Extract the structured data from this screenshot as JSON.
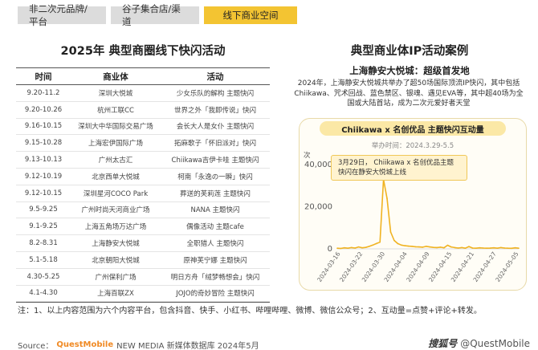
{
  "tabs": [
    {
      "label": "非二次元品牌/平台",
      "active": false
    },
    {
      "label": "谷子集合店/渠道",
      "active": false
    },
    {
      "label": "线下商业空间",
      "active": true
    }
  ],
  "left": {
    "title": "2025年 典型商圈线下快闪活动",
    "columns": [
      "时间",
      "商业体",
      "活动"
    ],
    "rows": [
      [
        "9.20-11.2",
        "深圳大悦城",
        "少女乐队的解构 主题快闪"
      ],
      [
        "9.20-10.26",
        "杭州工联CC",
        "世界之外「我即传说」快闪"
      ],
      [
        "9.16-10.15",
        "深圳大中华国际交易广场",
        "会长大人是女仆 主题快闪"
      ],
      [
        "9.15-10.28",
        "上海宏伊国际广场",
        "拓麻歌子「怀旧派对」快闪"
      ],
      [
        "9.13-10.13",
        "广州太古汇",
        "Chiikawa吉伊卡哇 主题快闪"
      ],
      [
        "9.12-10.19",
        "北京西单大悦城",
        "柯南「永逸の一瞬」快闪"
      ],
      [
        "9.12-10.15",
        "深圳星河COCO Park",
        "葬送的芙莉莲 主题快闪"
      ],
      [
        "9.5-9.25",
        "广州时尚天河商业广场",
        "NANA 主题快闪"
      ],
      [
        "9.1-9.25",
        "上海五角场万达广场",
        "偶像活动 主题cafe"
      ],
      [
        "8.2-8.31",
        "上海静安大悦城",
        "全职猎人 主题快闪"
      ],
      [
        "5.1-5.18",
        "北京朝阳大悦城",
        "原神芙宁娜 主题快闪"
      ],
      [
        "4.30-5.25",
        "广州保利广场",
        "明日方舟「绒梦畅想会」快闪"
      ],
      [
        "4.1-4.30",
        "上海百联ZX",
        "JOJO的奇妙冒险 主题快闪"
      ]
    ]
  },
  "right": {
    "title": "典型商业体IP活动案例",
    "case_title": "上海静安大悦城：超级首发地",
    "case_desc": "2024年，上海静安大悦城共举办了超50场国际顶流IP快闪，其中包括Chiikawa、咒术回战、蓝色禁区、银魂、遇见EVA等，其中超40场为全国或大陆首站，成为二次元爱好者天堂",
    "chart_header": "Chiikawa x 名创优品 主题快闪互动量",
    "period": "举办时间：2024.3.29-5.5",
    "callout": "3月29日， Chiikawa x 名创优品主题快闪在静安大悦城上线"
  },
  "chart_data": {
    "type": "line",
    "unit_label": "次",
    "ylim": [
      0,
      45000
    ],
    "yticks": [
      0,
      20000,
      40000
    ],
    "ytick_labels": [
      "0",
      "20,000",
      "40,000"
    ],
    "xtick_labels": [
      "2024-03-16",
      "2024-03-22",
      "2024-03-30",
      "2024-04-04",
      "2024-04-09",
      "2024-04-15",
      "2024-04-21",
      "2024-04-27",
      "2024-05-05"
    ],
    "line_color": "#f0b322",
    "values": [
      300,
      200,
      500,
      300,
      600,
      400,
      900,
      500,
      700,
      1200,
      1800,
      2500,
      3200,
      33000,
      24000,
      8000,
      4000,
      2500,
      1800,
      1500,
      1300,
      1200,
      1000,
      900,
      800,
      1200,
      900,
      700,
      600,
      800,
      500,
      1700,
      900,
      600,
      400,
      600,
      300,
      1100,
      400,
      300,
      500,
      400,
      300,
      350,
      500,
      300,
      600,
      400,
      300,
      250,
      500,
      300
    ]
  },
  "footer": {
    "note": "注：1、以上内容范围为六个内容平台，包含抖音、快手、小红书、哔哩哔哩、微博、微信公众号；2、互动量=点赞+评论+转发。",
    "source_label": "Source：",
    "source_brand": "QuestMobile",
    "source_rest": "NEW MEDIA 新媒体数据库 2024年5月",
    "brand_mark": "搜狐号",
    "brand_handle": "@QuestMobile"
  }
}
